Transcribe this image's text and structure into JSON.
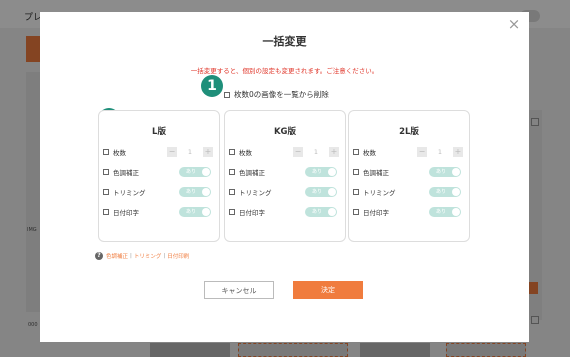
{
  "background": {
    "header_title": "プレ",
    "img_label": "IMG",
    "num_label": "000"
  },
  "modal": {
    "title": "一括変更",
    "warning": "一括変更すると、個別の設定も変更されます。ご注意ください。",
    "exclude_label": "枚数0の画像を一覧から削除",
    "close_icon": "×",
    "badges": [
      "1",
      "2"
    ],
    "cards": [
      {
        "title": "L版",
        "rows": [
          {
            "label": "枚数",
            "type": "stepper",
            "value": "1",
            "minus": "−",
            "plus": "+"
          },
          {
            "label": "色調補正",
            "type": "toggle",
            "state": "あり"
          },
          {
            "label": "トリミング",
            "type": "toggle",
            "state": "あり"
          },
          {
            "label": "日付印字",
            "type": "toggle",
            "state": "あり"
          }
        ]
      },
      {
        "title": "KG版",
        "rows": [
          {
            "label": "枚数",
            "type": "stepper",
            "value": "1",
            "minus": "−",
            "plus": "+"
          },
          {
            "label": "色調補正",
            "type": "toggle",
            "state": "あり"
          },
          {
            "label": "トリミング",
            "type": "toggle",
            "state": "あり"
          },
          {
            "label": "日付印字",
            "type": "toggle",
            "state": "あり"
          }
        ]
      },
      {
        "title": "2L版",
        "rows": [
          {
            "label": "枚数",
            "type": "stepper",
            "value": "1",
            "minus": "−",
            "plus": "+"
          },
          {
            "label": "色調補正",
            "type": "toggle",
            "state": "あり"
          },
          {
            "label": "トリミング",
            "type": "toggle",
            "state": "あり"
          },
          {
            "label": "日付印字",
            "type": "toggle",
            "state": "あり"
          }
        ]
      }
    ],
    "help": {
      "icon": "?",
      "links": [
        "色調補正",
        "トリミング",
        "日付印刷"
      ],
      "separator": "|"
    },
    "buttons": {
      "cancel": "キャンセル",
      "ok": "決定"
    }
  },
  "colors": {
    "accent": "#f07c3e",
    "badge": "#1f8f7a",
    "warning": "#e0372b",
    "toggle_on": "#bfe3dc"
  }
}
